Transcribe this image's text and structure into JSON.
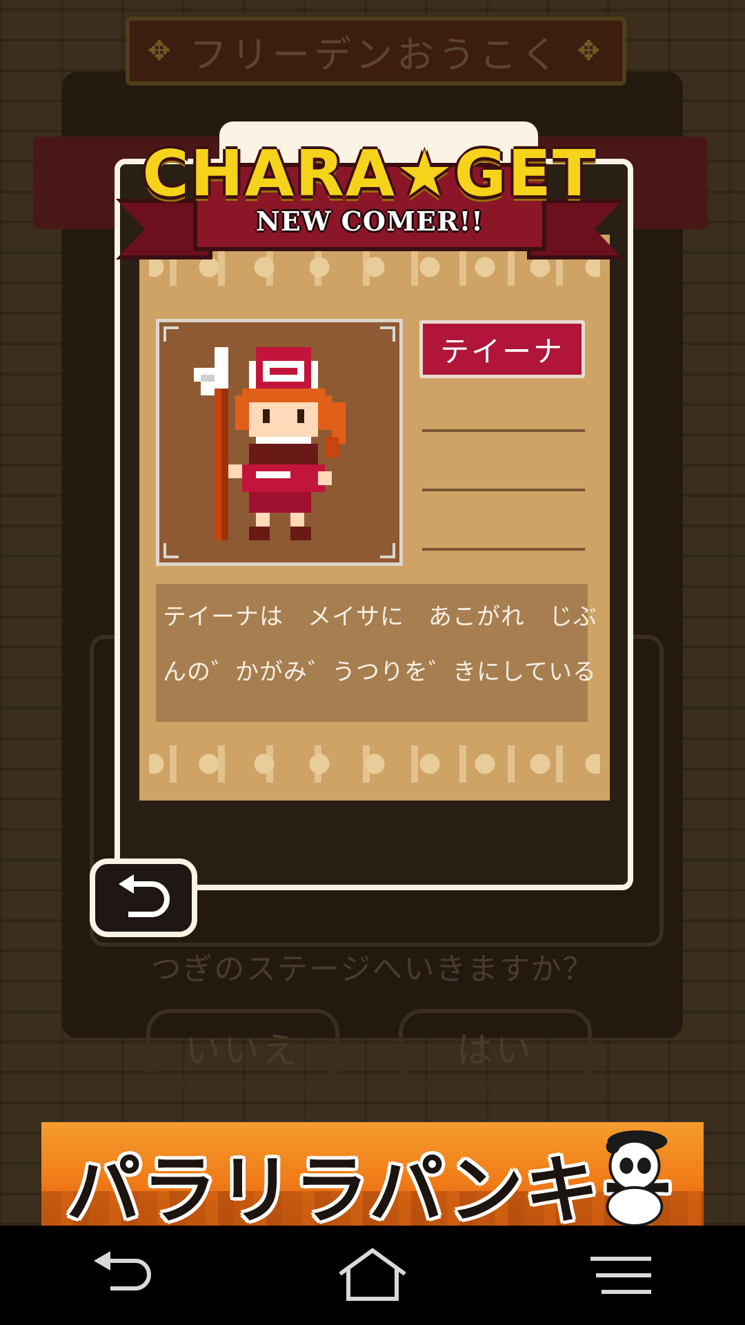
{
  "background": {
    "location_title": "フリーデンおうこく",
    "question": "つぎのステージへいきますか？",
    "no_label": "いいえ",
    "yes_label": "はい"
  },
  "modal": {
    "header_title": "CHARA★GET",
    "header_subtitle": "NEW COMER!!",
    "character_name": "テイーナ",
    "description_lines": [
      "テイーナは　メイサに　あこがれ　じぶ",
      "んの゛かがみ゛うつりを゛きにしている"
    ]
  },
  "ad": {
    "text": "パラリラパンキー"
  },
  "colors": {
    "ribbon": "#8a1627",
    "title_yellow": "#f6d31b",
    "card": "#cfa265",
    "name_plate": "#b1153a"
  },
  "icons": {
    "back": "return-arrow-icon",
    "nav_back": "back-arrow-icon",
    "nav_home": "home-icon",
    "nav_menu": "menu-icon"
  }
}
